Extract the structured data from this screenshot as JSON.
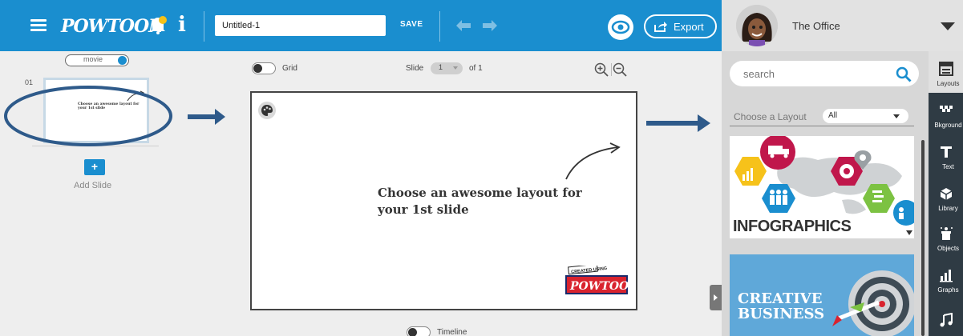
{
  "header": {
    "logo_text": "POWTOON",
    "info_glyph": "i",
    "title_value": "Untitled-1",
    "save_label": "SAVE",
    "export_label": "Export",
    "brand_color": "#1a8ecf"
  },
  "profile": {
    "name": "The Office"
  },
  "left_panel": {
    "mode_label": "movie",
    "slide_number": "01",
    "thumbnail_text": "Choose an awesome layout for your 1st slide",
    "add_slide_glyph": "+",
    "add_slide_label": "Add Slide"
  },
  "canvas_toolbar": {
    "grid_label": "Grid",
    "slide_label": "Slide",
    "current_slide": "1",
    "of_label": "of 1",
    "timeline_label": "Timeline"
  },
  "canvas": {
    "main_text": "Choose an awesome layout for your 1st slide",
    "badge_top": "CREATED USING",
    "badge_bottom": "POWTOON"
  },
  "library": {
    "search_placeholder": "search",
    "layout_label": "Choose a Layout",
    "layout_filter": "All",
    "cards": [
      {
        "title": "INFOGRAPHICS"
      },
      {
        "title_line1": "CREATIVE",
        "title_line2": "BUSINESS"
      }
    ]
  },
  "tools": [
    {
      "label": "Layouts",
      "icon": "layouts-icon"
    },
    {
      "label": "Bkground",
      "icon": "background-icon"
    },
    {
      "label": "Text",
      "icon": "text-icon"
    },
    {
      "label": "Library",
      "icon": "library-icon"
    },
    {
      "label": "Objects",
      "icon": "objects-icon"
    },
    {
      "label": "Graphs",
      "icon": "graphs-icon"
    },
    {
      "label": "",
      "icon": "music-icon"
    }
  ]
}
